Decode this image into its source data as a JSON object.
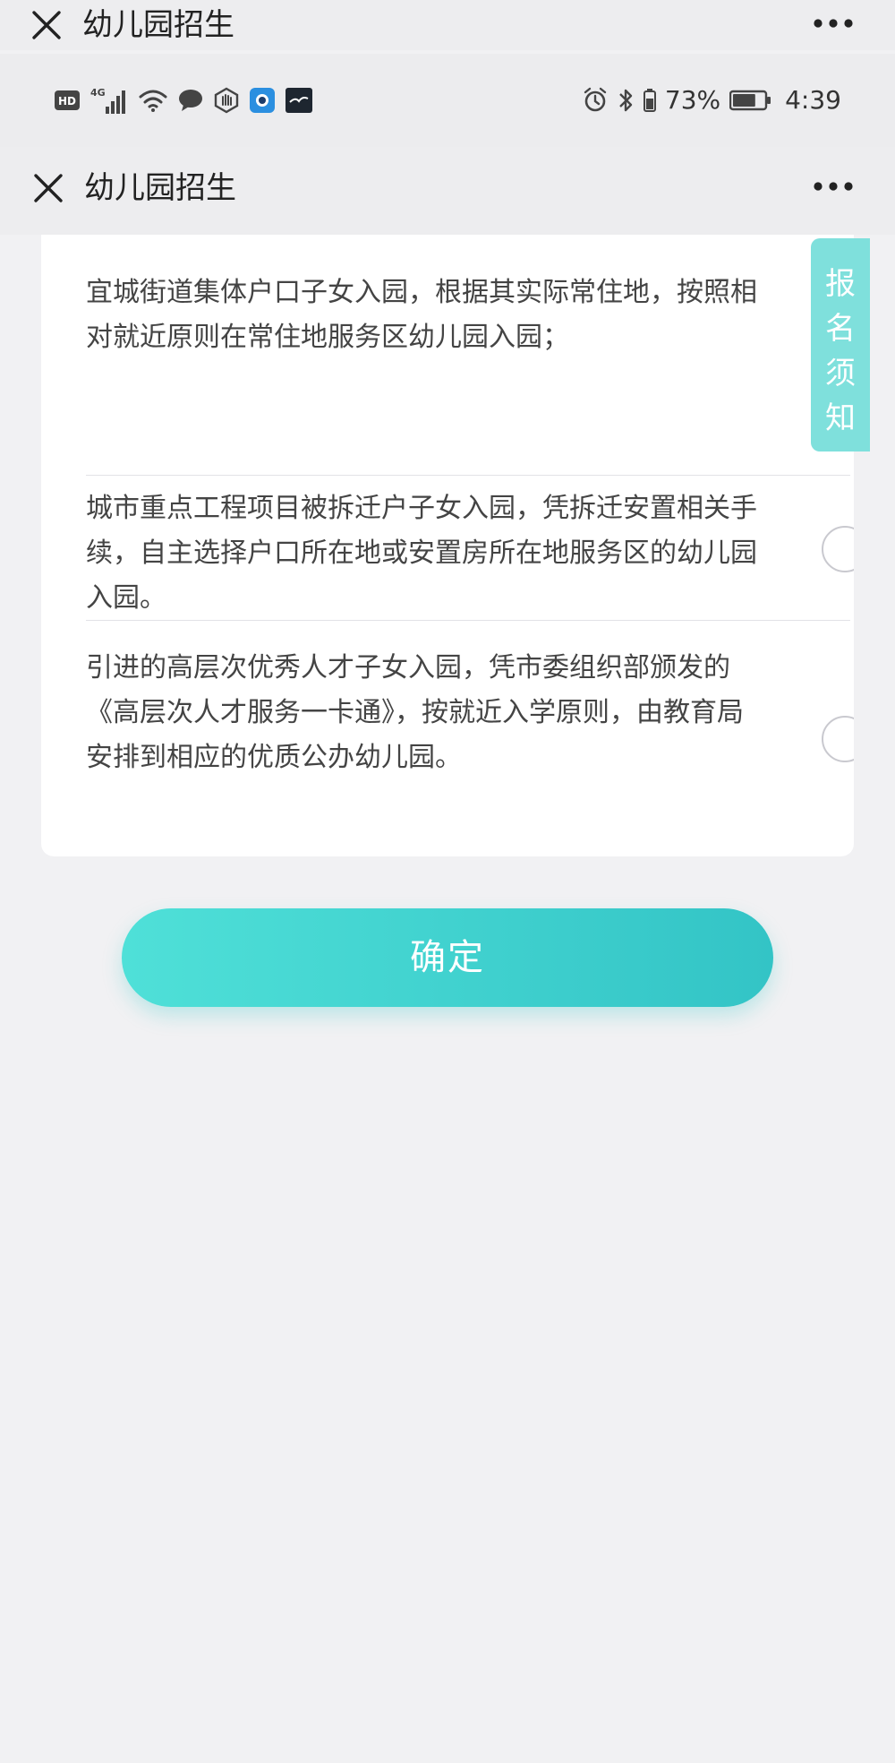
{
  "ghost_bar": {
    "title": "幼儿园招生"
  },
  "status_bar": {
    "left_icons": [
      "hd-icon",
      "signal-4g-icon",
      "wifi-icon",
      "chat-bubble-icon",
      "hand-icon",
      "app-icon-blue",
      "bird-app-icon"
    ],
    "left_labels": {
      "hd": "HD",
      "network": "4G"
    },
    "right_icons": [
      "alarm-icon",
      "bluetooth-icon",
      "battery-icon"
    ],
    "battery_percent": "73%",
    "time": "4:39"
  },
  "header": {
    "title": "幼儿园招生"
  },
  "notice_tab": {
    "chars": [
      "报",
      "名",
      "须",
      "知"
    ]
  },
  "options": [
    {
      "text": "宜城街道集体户口子女入园，根据其实际常住地，按照相对就近原则在常住地服务区幼儿园入园；",
      "selected": false
    },
    {
      "text": "城市重点工程项目被拆迁户子女入园，凭拆迁安置相关手续，自主选择户口所在地或安置房所在地服务区的幼儿园入园。",
      "selected": false
    },
    {
      "text": "引进的高层次优秀人才子女入园，凭市委组织部颁发的《高层次人才服务一卡通》，按就近入学原则，由教育局安排到相应的优质公办幼儿园。",
      "selected": false
    }
  ],
  "confirm_button": {
    "label": "确定"
  },
  "colors": {
    "accent": "#3fd3d0",
    "tab": "#7fe0dc",
    "background": "#f1f1f3"
  }
}
